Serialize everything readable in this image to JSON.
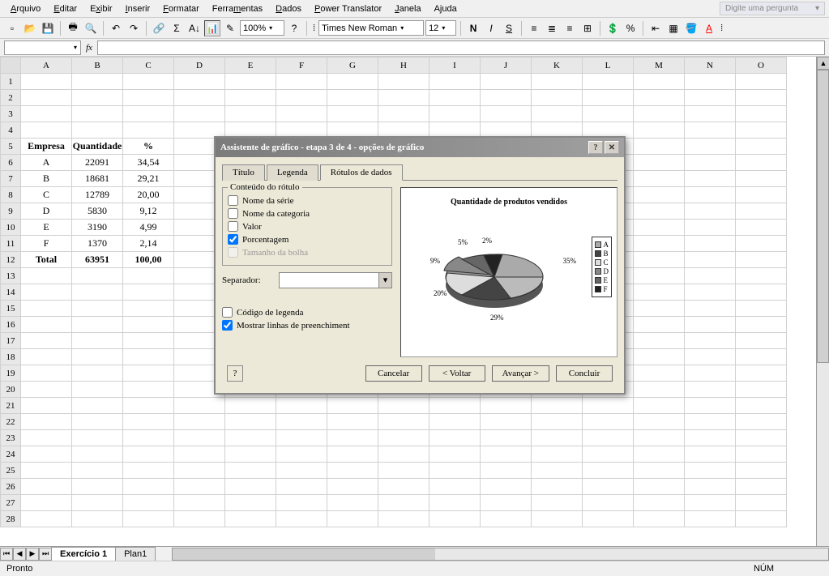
{
  "menus": [
    "Arquivo",
    "Editar",
    "Exibir",
    "Inserir",
    "Formatar",
    "Ferramentas",
    "Dados",
    "Power Translator",
    "Janela",
    "Ajuda"
  ],
  "menu_accel": [
    "A",
    "E",
    "x",
    "I",
    "F",
    "m",
    "D",
    "P",
    "J",
    "j"
  ],
  "ask_placeholder": "Digite uma pergunta",
  "toolbar": {
    "zoom": "100%",
    "font": "Times New Roman",
    "size": "12"
  },
  "name_box": "",
  "sheet": {
    "columns": [
      "A",
      "B",
      "C",
      "D",
      "E",
      "F",
      "G",
      "H",
      "I",
      "J",
      "K",
      "L",
      "M",
      "N",
      "O"
    ],
    "rows": 28,
    "data": {
      "5": {
        "A": "Empresa",
        "B": "Quantidade",
        "C": "%",
        "bold": true
      },
      "6": {
        "A": "A",
        "B": "22091",
        "C": "34,54"
      },
      "7": {
        "A": "B",
        "B": "18681",
        "C": "29,21"
      },
      "8": {
        "A": "C",
        "B": "12789",
        "C": "20,00"
      },
      "9": {
        "A": "D",
        "B": "5830",
        "C": "9,12"
      },
      "10": {
        "A": "E",
        "B": "3190",
        "C": "4,99"
      },
      "11": {
        "A": "F",
        "B": "1370",
        "C": "2,14"
      },
      "12": {
        "A": "Total",
        "B": "63951",
        "C": "100,00",
        "bold": true
      }
    }
  },
  "tabs": {
    "active": "Exercício 1",
    "others": [
      "Plan1"
    ]
  },
  "status": {
    "left": "Pronto",
    "right": "NÚM"
  },
  "dialog": {
    "title": "Assistente de gráfico - etapa 3 de 4 - opções de gráfico",
    "tabs": [
      "Título",
      "Legenda",
      "Rótulos de dados"
    ],
    "active_tab": 2,
    "fieldset_label": "Conteúdo do rótulo",
    "options": {
      "serie": "Nome da série",
      "categoria": "Nome da categoria",
      "valor": "Valor",
      "porcentagem": "Porcentagem",
      "bolha": "Tamanho da bolha"
    },
    "checked": {
      "serie": false,
      "categoria": false,
      "valor": false,
      "porcentagem": true,
      "bolha": false
    },
    "separador_label": "Separador:",
    "codigo_legenda": "Código de legenda",
    "linhas_preench": "Mostrar linhas de preenchiment",
    "checked2": {
      "codigo": false,
      "linhas": true
    },
    "preview_title": "Quantidade de produtos vendidos",
    "legend": [
      "A",
      "B",
      "C",
      "D",
      "E",
      "F"
    ],
    "percents": [
      "35%",
      "29%",
      "20%",
      "9%",
      "5%",
      "2%"
    ],
    "buttons": {
      "cancel": "Cancelar",
      "back": "< Voltar",
      "next": "Avançar >",
      "finish": "Concluir"
    }
  },
  "chart_data": {
    "type": "pie",
    "title": "Quantidade de produtos vendidos",
    "categories": [
      "A",
      "B",
      "C",
      "D",
      "E",
      "F"
    ],
    "values": [
      35,
      29,
      20,
      9,
      5,
      2
    ],
    "series": [
      {
        "name": "Quantidade",
        "values": [
          35,
          29,
          20,
          9,
          5,
          2
        ]
      }
    ],
    "labels_shown": "percentage"
  }
}
